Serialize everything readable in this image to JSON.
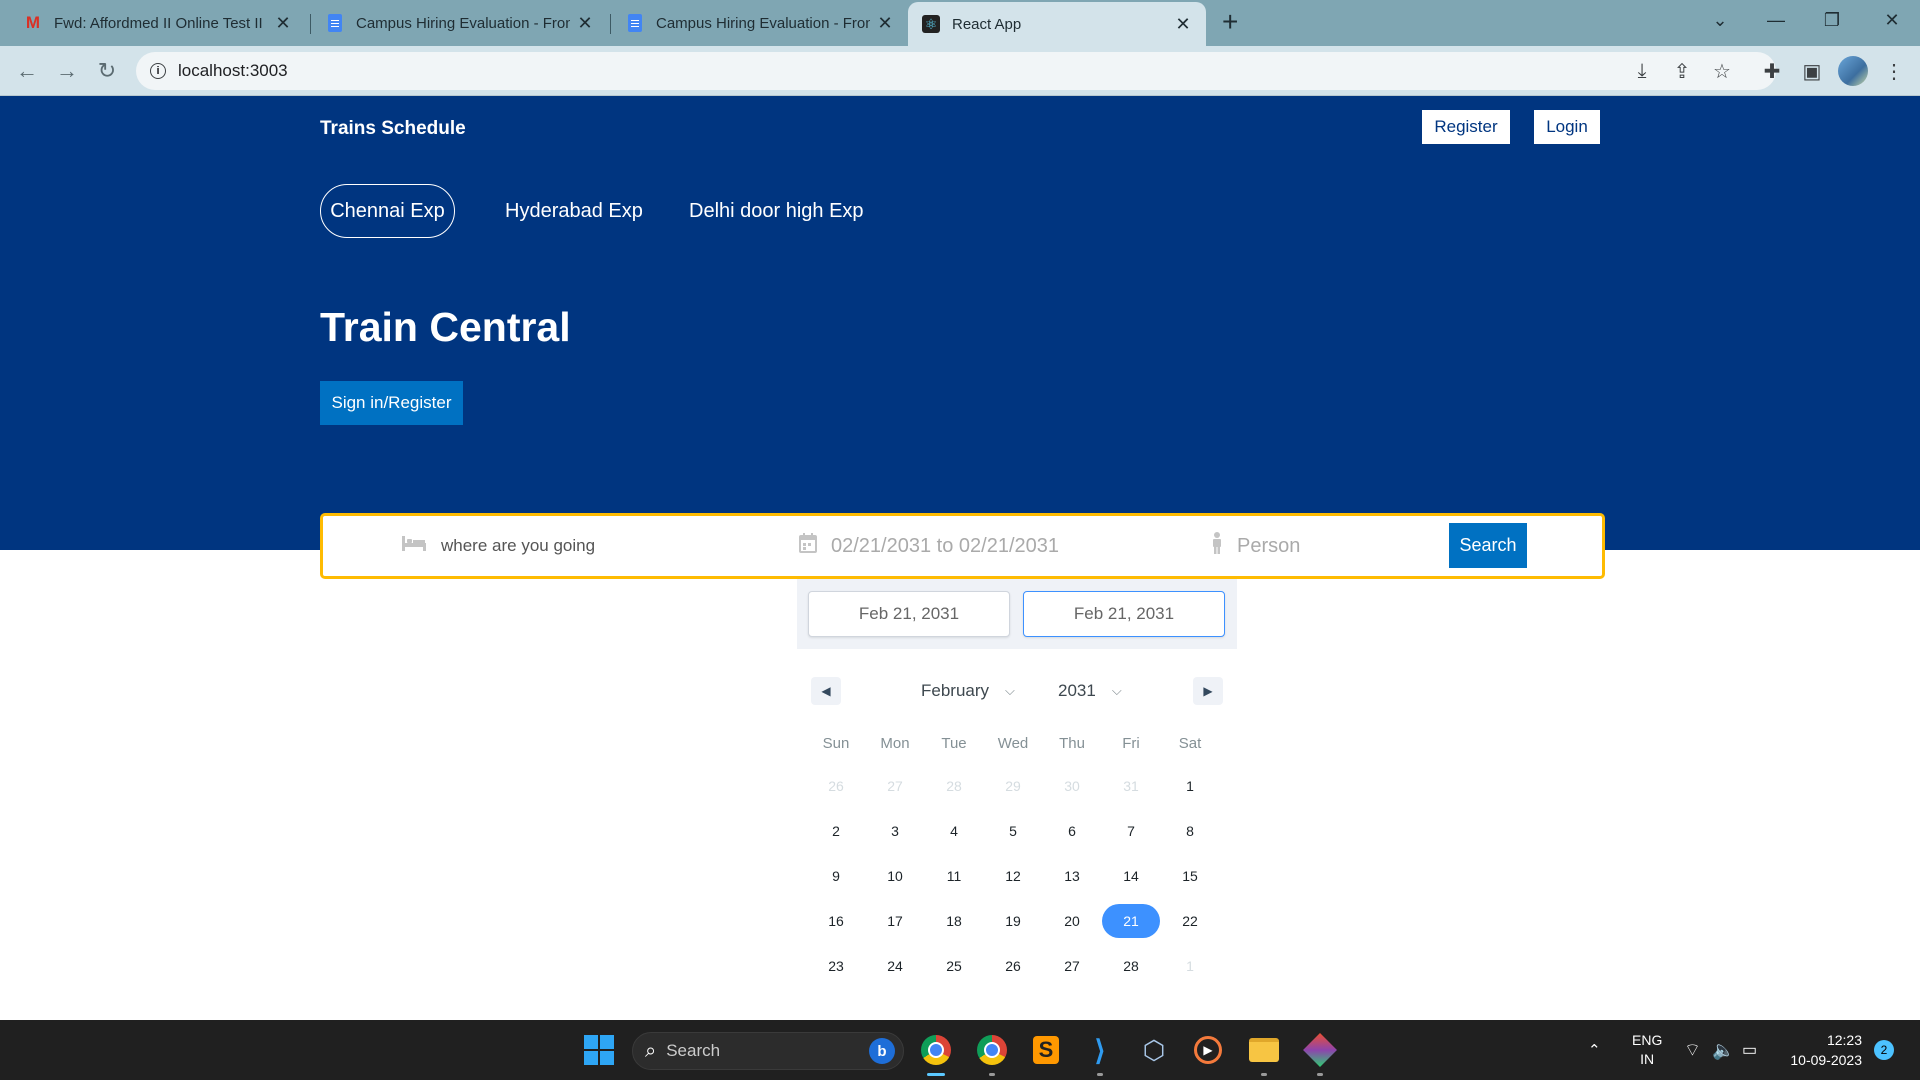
{
  "browser": {
    "tabs": [
      {
        "title": "Fwd: Affordmed II Online Test II F",
        "icon": "gmail-icon"
      },
      {
        "title": "Campus Hiring Evaluation - Front",
        "icon": "docs-icon"
      },
      {
        "title": "Campus Hiring Evaluation - Front",
        "icon": "docs-icon"
      },
      {
        "title": "React App",
        "icon": "react-icon"
      }
    ],
    "address": "localhost:3003"
  },
  "page": {
    "brand": "Trains Schedule",
    "register_label": "Register",
    "login_label": "Login",
    "nav": [
      "Chennai Exp",
      "Hyderabad Exp",
      "Delhi door high Exp"
    ],
    "active_nav": "Chennai Exp",
    "hero_title": "Train Central",
    "signin_label": "Sign in/Register",
    "search": {
      "destination_placeholder": "where are you going",
      "date_range": "02/21/2031 to 02/21/2031",
      "person_placeholder": "Person",
      "button": "Search"
    }
  },
  "datepicker": {
    "start_input": "Feb 21, 2031",
    "end_input": "Feb 21, 2031",
    "month": "February",
    "year": "2031",
    "weekdays": [
      "Sun",
      "Mon",
      "Tue",
      "Wed",
      "Thu",
      "Fri",
      "Sat"
    ],
    "weeks": [
      [
        {
          "d": "26",
          "p": true
        },
        {
          "d": "27",
          "p": true
        },
        {
          "d": "28",
          "p": true
        },
        {
          "d": "29",
          "p": true
        },
        {
          "d": "30",
          "p": true
        },
        {
          "d": "31",
          "p": true
        },
        {
          "d": "1",
          "p": false
        }
      ],
      [
        {
          "d": "2",
          "p": false
        },
        {
          "d": "3",
          "p": false
        },
        {
          "d": "4",
          "p": false
        },
        {
          "d": "5",
          "p": false
        },
        {
          "d": "6",
          "p": false
        },
        {
          "d": "7",
          "p": false
        },
        {
          "d": "8",
          "p": false
        }
      ],
      [
        {
          "d": "9",
          "p": false
        },
        {
          "d": "10",
          "p": false
        },
        {
          "d": "11",
          "p": false
        },
        {
          "d": "12",
          "p": false
        },
        {
          "d": "13",
          "p": false
        },
        {
          "d": "14",
          "p": false
        },
        {
          "d": "15",
          "p": false
        }
      ],
      [
        {
          "d": "16",
          "p": false
        },
        {
          "d": "17",
          "p": false
        },
        {
          "d": "18",
          "p": false
        },
        {
          "d": "19",
          "p": false
        },
        {
          "d": "20",
          "p": false
        },
        {
          "d": "21",
          "p": false
        },
        {
          "d": "22",
          "p": false
        }
      ],
      [
        {
          "d": "23",
          "p": false
        },
        {
          "d": "24",
          "p": false
        },
        {
          "d": "25",
          "p": false
        },
        {
          "d": "26",
          "p": false
        },
        {
          "d": "27",
          "p": false
        },
        {
          "d": "28",
          "p": false
        },
        {
          "d": "1",
          "p": true
        }
      ]
    ],
    "selected_day": "21",
    "selected_color": "#3d91ff"
  },
  "taskbar": {
    "search_placeholder": "Search",
    "lang_top": "ENG",
    "lang_bottom": "IN",
    "time": "12:23",
    "date": "10-09-2023",
    "notifications": "2"
  },
  "colors": {
    "hero_bg": "#003580",
    "search_border": "#febb02",
    "primary_button": "#0071c2"
  }
}
